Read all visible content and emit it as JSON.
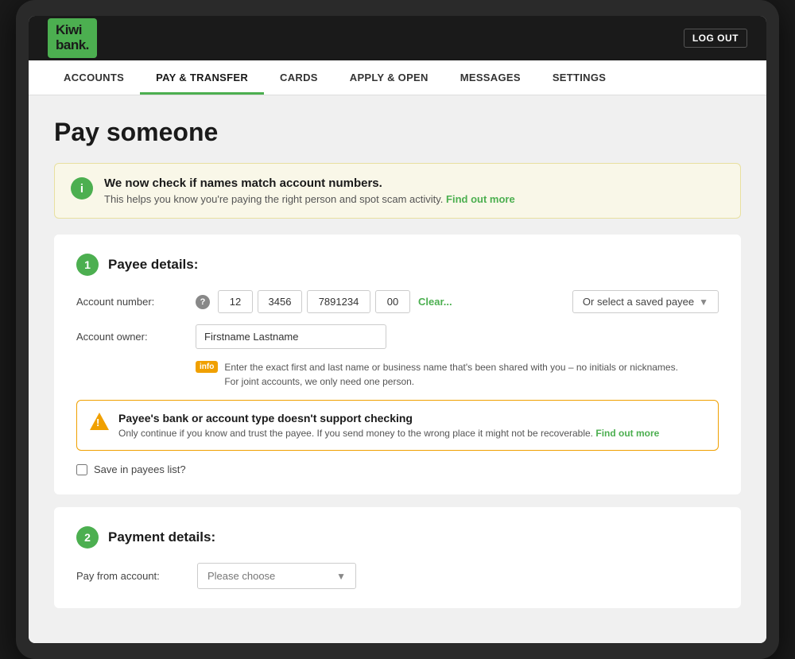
{
  "app": {
    "logo_line1": "Kiwi",
    "logo_line2": "bank.",
    "logout_label": "LOG OUT"
  },
  "nav": {
    "items": [
      {
        "id": "accounts",
        "label": "ACCOUNTS",
        "active": false
      },
      {
        "id": "pay-transfer",
        "label": "PAY & TRANSFER",
        "active": true
      },
      {
        "id": "cards",
        "label": "CARDS",
        "active": false
      },
      {
        "id": "apply-open",
        "label": "APPLY & OPEN",
        "active": false
      },
      {
        "id": "messages",
        "label": "MESSAGES",
        "active": false
      },
      {
        "id": "settings",
        "label": "SETTINGS",
        "active": false
      }
    ]
  },
  "page": {
    "title": "Pay someone"
  },
  "info_banner": {
    "icon": "i",
    "heading": "We now check if names match account numbers.",
    "body": "This helps you know you're paying the right person and spot scam activity.",
    "link_text": "Find out more"
  },
  "payee_section": {
    "step": "1",
    "title": "Payee details:",
    "account_label": "Account number:",
    "help_icon": "?",
    "acct_part1": "12",
    "acct_part2": "3456",
    "acct_part3": "7891234",
    "acct_part4": "00",
    "clear_label": "Clear...",
    "select_payee_label": "Or select a saved payee",
    "owner_label": "Account owner:",
    "owner_value": "Firstname Lastname",
    "info_tag": "info",
    "info_note": "Enter the exact first and last name or business name that's been shared with you – no initials or nicknames.\nFor joint accounts, we only need one person.",
    "warning_heading": "Payee's bank or account type doesn't support checking",
    "warning_body": "Only continue if you know and trust the payee. If you send money to the wrong place it might not be recoverable.",
    "warning_link": "Find out more",
    "save_payee_label": "Save in payees list?"
  },
  "payment_section": {
    "step": "2",
    "title": "Payment details:",
    "pay_from_label": "Pay from account:",
    "pay_from_placeholder": "Please choose"
  }
}
